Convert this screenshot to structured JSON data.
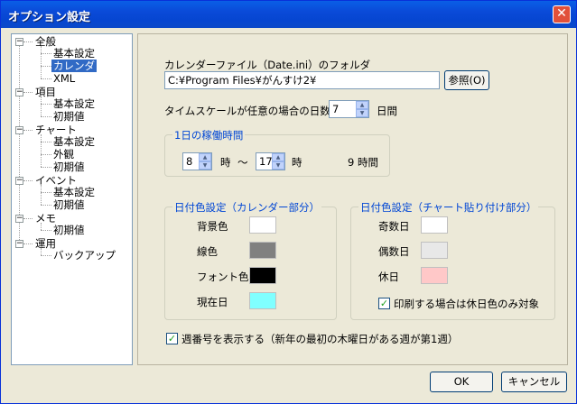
{
  "window": {
    "title": "オプション設定",
    "close_glyph": "✕"
  },
  "tree": {
    "items": [
      {
        "label": "全般",
        "toggle": "−"
      },
      {
        "label": "基本設定"
      },
      {
        "label": "カレンダ"
      },
      {
        "label": "XML"
      },
      {
        "label": "項目",
        "toggle": "−"
      },
      {
        "label": "基本設定"
      },
      {
        "label": "初期値"
      },
      {
        "label": "チャート",
        "toggle": "−"
      },
      {
        "label": "基本設定"
      },
      {
        "label": "外観"
      },
      {
        "label": "初期値"
      },
      {
        "label": "イベント",
        "toggle": "−"
      },
      {
        "label": "基本設定"
      },
      {
        "label": "初期値"
      },
      {
        "label": "メモ",
        "toggle": "−"
      },
      {
        "label": "初期値"
      },
      {
        "label": "運用",
        "toggle": "−"
      },
      {
        "label": "バックアップ"
      }
    ]
  },
  "calendar": {
    "folder_label": "カレンダーファイル（Date.ini）のフォルダ",
    "folder_value": "C:¥Program Files¥がんすけ2¥",
    "browse_label": "参照(O)",
    "timescale_label": "タイムスケールが任意の場合の日数",
    "timescale_value": "7",
    "timescale_unit": "日間"
  },
  "work_hours": {
    "group_title": "1日の稼働時間",
    "start_value": "8",
    "start_unit": "時",
    "tilde": "～",
    "end_value": "17",
    "end_unit": "時",
    "total": "9 時間"
  },
  "day_colors_calendar": {
    "group_title": "日付色設定（カレンダー部分）",
    "rows": [
      {
        "label": "背景色",
        "color": "#ffffff"
      },
      {
        "label": "線色",
        "color": "#808080"
      },
      {
        "label": "フォント色",
        "color": "#000000"
      },
      {
        "label": "現在日",
        "color": "#80ffff"
      }
    ]
  },
  "day_colors_chart": {
    "group_title": "日付色設定（チャート貼り付け部分）",
    "rows": [
      {
        "label": "奇数日",
        "color": "#ffffff"
      },
      {
        "label": "偶数日",
        "color": "#e8e8e8"
      },
      {
        "label": "休日",
        "color": "#ffc8c8"
      }
    ],
    "print_holiday_label": "印刷する場合は休日色のみ対象",
    "print_holiday_checked": true
  },
  "week_number": {
    "label": "週番号を表示する（新年の最初の木曜日がある週が第1週）",
    "checked": true
  },
  "buttons": {
    "ok": "OK",
    "cancel": "キャンセル"
  },
  "spin_glyphs": {
    "up": "▲",
    "down": "▼"
  },
  "check_glyph": "✓"
}
